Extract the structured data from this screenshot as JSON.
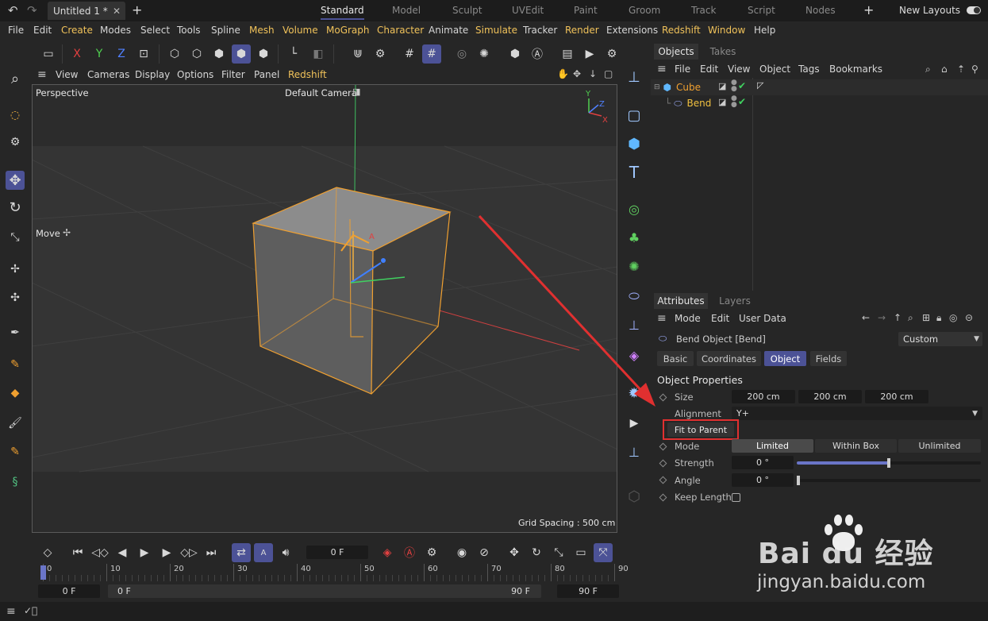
{
  "titlebar": {
    "doc_tab": "Untitled 1 *",
    "layouts": [
      "Standard",
      "Model",
      "Sculpt",
      "UVEdit",
      "Paint",
      "Groom",
      "Track",
      "Script",
      "Nodes"
    ],
    "new_layouts": "New Layouts"
  },
  "menu": {
    "items": [
      "File",
      "Edit",
      "Create",
      "Modes",
      "Select",
      "Tools",
      "Spline",
      "Mesh",
      "Volume",
      "MoGraph",
      "Character",
      "Animate",
      "Simulate",
      "Tracker",
      "Render",
      "Extensions",
      "Redshift",
      "Window",
      "Help"
    ]
  },
  "viewport": {
    "menu": [
      "View",
      "Cameras",
      "Display",
      "Options",
      "Filter",
      "Panel"
    ],
    "menu_redshift": "Redshift",
    "label": "Perspective",
    "camera": "Default Camera",
    "move_label": "Move",
    "grid_spacing": "Grid Spacing : 500 cm",
    "axis_x": "X",
    "axis_y": "Y",
    "axis_z": "Z"
  },
  "objects": {
    "tabs": [
      "Objects",
      "Takes"
    ],
    "menu": [
      "File",
      "Edit",
      "View",
      "Object",
      "Tags",
      "Bookmarks"
    ],
    "items": [
      {
        "name": "Cube",
        "color": "#f0a030"
      },
      {
        "name": "Bend",
        "color": "#f0c040"
      }
    ]
  },
  "attributes": {
    "tabs": [
      "Attributes",
      "Layers"
    ],
    "menu": [
      "Mode",
      "Edit",
      "User Data"
    ],
    "object_title": "Bend Object [Bend]",
    "preset": "Custom",
    "subtabs": [
      "Basic",
      "Coordinates",
      "Object",
      "Fields"
    ],
    "section": "Object Properties",
    "size_label": "Size",
    "size_values": [
      "200 cm",
      "200 cm",
      "200 cm"
    ],
    "alignment_label": "Alignment",
    "alignment_value": "Y+",
    "fit_button": "Fit to Parent",
    "mode_label": "Mode",
    "mode_options": [
      "Limited",
      "Within Box",
      "Unlimited"
    ],
    "strength_label": "Strength",
    "strength_value": "0 °",
    "strength_fraction": 0.5,
    "angle_label": "Angle",
    "angle_value": "0 °",
    "keep_length_label": "Keep Length"
  },
  "timeline": {
    "current_frame": "0 F",
    "ticks": [
      "0",
      "10",
      "20",
      "30",
      "40",
      "50",
      "60",
      "70",
      "80",
      "90"
    ],
    "start": "0 F",
    "range_start": "0 F",
    "range_end": "90 F",
    "end": "90 F"
  },
  "watermark": {
    "brand": "Bai du 经验",
    "url": "jingyan.baidu.com"
  },
  "colors": {
    "accent": "#4c5296",
    "highlight_red": "#e03030",
    "selection_orange": "#f0a030"
  }
}
